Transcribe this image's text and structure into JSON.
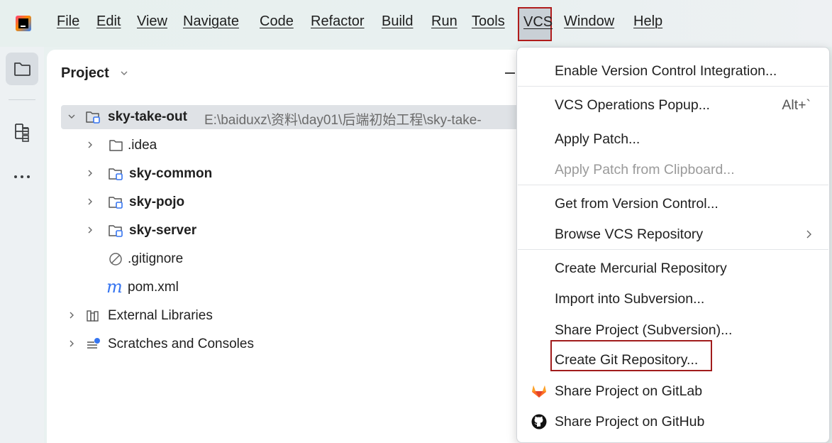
{
  "menubar": {
    "items": [
      {
        "label": "File"
      },
      {
        "label": "Edit"
      },
      {
        "label": "View"
      },
      {
        "label": "Navigate"
      },
      {
        "label": "Code"
      },
      {
        "label": "Refactor"
      },
      {
        "label": "Build"
      },
      {
        "label": "Run"
      },
      {
        "label": "Tools"
      },
      {
        "label": "VCS"
      },
      {
        "label": "Window"
      },
      {
        "label": "Help"
      }
    ]
  },
  "toolstrip": {
    "items": [
      "project-tool",
      "structure-tool",
      "more-tools"
    ]
  },
  "project_panel": {
    "title": "Project",
    "tree": [
      {
        "label": "sky-take-out",
        "path": "E:\\baiduxz\\资料\\day01\\后端初始工程\\sky-take-",
        "expanded": true,
        "selected": true
      },
      {
        "label": ".idea"
      },
      {
        "label": "sky-common"
      },
      {
        "label": "sky-pojo"
      },
      {
        "label": "sky-server"
      },
      {
        "label": ".gitignore"
      },
      {
        "label": "pom.xml"
      },
      {
        "label": "External Libraries"
      },
      {
        "label": "Scratches and Consoles"
      }
    ]
  },
  "vcs_menu": {
    "items": [
      {
        "label": "Enable Version Control Integration...",
        "enabled": true
      },
      {
        "label": "VCS Operations Popup...",
        "shortcut": "Alt+`",
        "enabled": true
      },
      {
        "label": "Apply Patch...",
        "enabled": true
      },
      {
        "label": "Apply Patch from Clipboard...",
        "enabled": false
      },
      {
        "label": "Get from Version Control...",
        "enabled": true
      },
      {
        "label": "Browse VCS Repository",
        "submenu": true,
        "enabled": true
      },
      {
        "label": "Create Mercurial Repository",
        "enabled": true
      },
      {
        "label": "Import into Subversion...",
        "enabled": true
      },
      {
        "label": "Share Project (Subversion)...",
        "enabled": true
      },
      {
        "label": "Create Git Repository...",
        "enabled": true,
        "highlighted": true
      },
      {
        "label": "Share Project on GitLab",
        "icon": "gitlab-icon",
        "enabled": true
      },
      {
        "label": "Share Project on GitHub",
        "icon": "github-icon",
        "enabled": true
      }
    ]
  },
  "colors": {
    "highlight_border": "#a11c1c",
    "menubar_bg": "#e7f0ee",
    "disabled_text": "#9a9a9a",
    "module_icon_blue": "#3574f0"
  }
}
